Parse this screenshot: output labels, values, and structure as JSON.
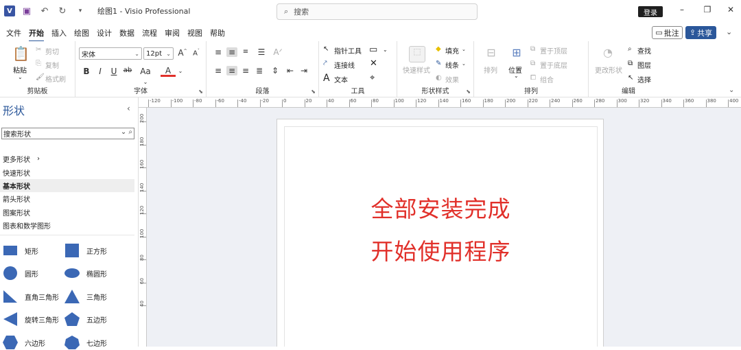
{
  "titlebar": {
    "doc_title": "绘图1  -  Visio Professional",
    "search_placeholder": "搜索",
    "login_label": "登录",
    "minimize": "–",
    "maximize": "❐",
    "close": "✕"
  },
  "menu": {
    "items": [
      "文件",
      "开始",
      "插入",
      "绘图",
      "设计",
      "数据",
      "流程",
      "审阅",
      "视图",
      "帮助"
    ],
    "active": "开始",
    "comment_label": "批注",
    "share_label": "共享"
  },
  "ribbon": {
    "clipboard": {
      "label": "剪贴板",
      "paste": "粘贴",
      "cut": "剪切",
      "copy": "复制",
      "format_painter": "格式刷"
    },
    "font": {
      "label": "字体",
      "font_name": "宋体",
      "font_size": "12pt",
      "increase": "A",
      "decrease": "A",
      "bold": "B",
      "italic": "I",
      "underline": "U",
      "strike": "ab",
      "case": "Aa",
      "color": "A"
    },
    "paragraph": {
      "label": "段落"
    },
    "tools": {
      "label": "工具",
      "pointer": "指针工具",
      "connector": "连接线",
      "text": "文本"
    },
    "shape_styles": {
      "label": "形状样式",
      "quick_styles": "快速样式",
      "fill": "填充",
      "line": "线条",
      "effects": "效果"
    },
    "arrange": {
      "label": "排列",
      "align": "排列",
      "position": "位置",
      "bring_front": "置于顶层",
      "send_back": "置于底层",
      "group": "组合"
    },
    "editing": {
      "label": "编辑",
      "change_shape": "更改形状",
      "find": "查找",
      "layers": "图层",
      "select": "选择"
    }
  },
  "shapes_panel": {
    "title": "形状",
    "search_placeholder": "搜索形状",
    "more_shapes": "更多形状",
    "stencils": [
      "快速形状",
      "基本形状",
      "箭头形状",
      "图案形状",
      "图表和数学图形"
    ],
    "active_stencil": "基本形状",
    "shapes": [
      {
        "label": "矩形",
        "icon": "rectangle-icon"
      },
      {
        "label": "正方形",
        "icon": "square-icon"
      },
      {
        "label": "圆形",
        "icon": "circle-icon"
      },
      {
        "label": "椭圆形",
        "icon": "ellipse-icon"
      },
      {
        "label": "直角三角形",
        "icon": "right-triangle-icon"
      },
      {
        "label": "三角形",
        "icon": "triangle-icon"
      },
      {
        "label": "旋转三角形",
        "icon": "rotated-triangle-icon"
      },
      {
        "label": "五边形",
        "icon": "pentagon-icon"
      },
      {
        "label": "六边形",
        "icon": "hexagon-icon"
      },
      {
        "label": "七边形",
        "icon": "heptagon-icon"
      }
    ],
    "shape_color": "#3b68b5"
  },
  "ruler": {
    "h_ticks": [
      "-120",
      "-100",
      "-80",
      "-60",
      "-40",
      "-20",
      "0",
      "20",
      "40",
      "60",
      "80",
      "100",
      "120",
      "140",
      "160",
      "180",
      "200",
      "220",
      "240",
      "260",
      "280",
      "300",
      "320",
      "340",
      "360",
      "380",
      "400"
    ],
    "v_ticks": [
      "200",
      "180",
      "160",
      "140",
      "120",
      "100",
      "80",
      "60",
      "40"
    ]
  },
  "canvas": {
    "line1": "全部安装完成",
    "line2": "开始使用程序",
    "text_color": "#e1302a"
  },
  "colors": {
    "accent": "#2b579a",
    "canvas_bg": "#eef0f5"
  }
}
